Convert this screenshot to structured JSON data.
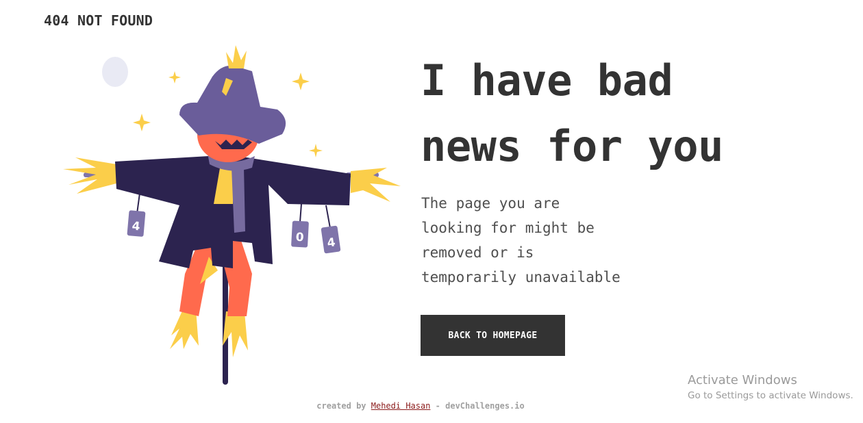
{
  "header": {
    "brand": "404 NOT FOUND"
  },
  "illustration": {
    "can_labels": [
      "4",
      "0",
      "4"
    ],
    "colors": {
      "hat": "#6A5D9A",
      "head": "#FF6A4D",
      "coat": "#2C234F",
      "scarf": "#776B9F",
      "straw": "#FBCE4A",
      "pants": "#FF6A4D",
      "pole": "#2C234F",
      "moon": "#E9EAF4",
      "can": "#7F74AA"
    }
  },
  "main": {
    "headline_line1": "I have bad",
    "headline_line2": "news for you",
    "description_lines": [
      "The page you are",
      "looking for might be",
      "removed or is",
      "temporarily unavailable"
    ],
    "cta_label": "BACK TO HOMEPAGE"
  },
  "footer": {
    "prefix": "created by ",
    "author": "Mehedi Hasan",
    "suffix": " - devChallenges.io"
  },
  "os_watermark": {
    "title": "Activate Windows",
    "subtitle": "Go to Settings to activate Windows."
  }
}
